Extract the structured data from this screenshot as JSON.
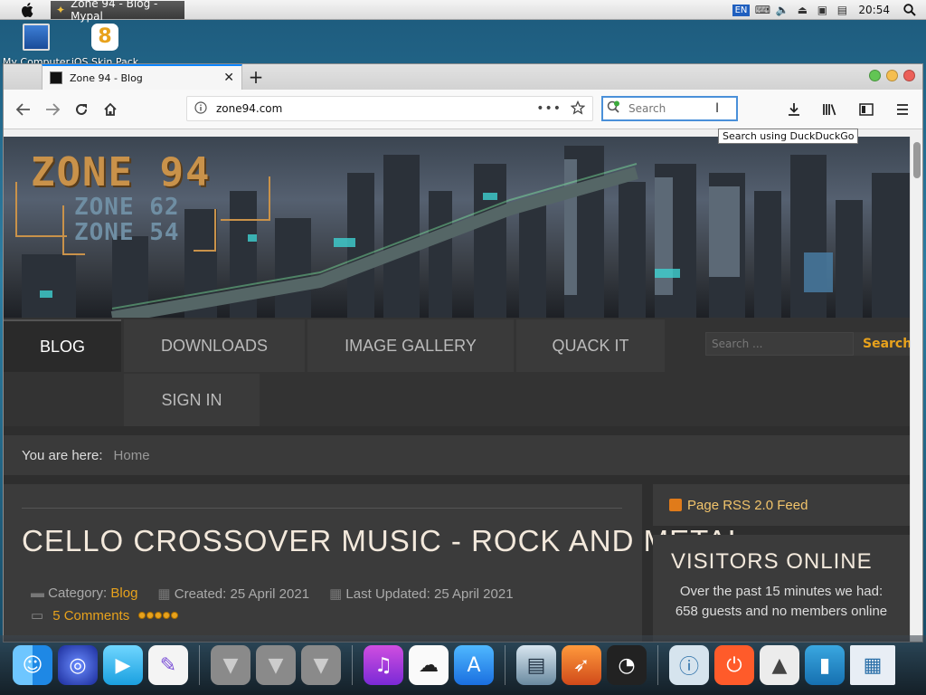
{
  "menubar": {
    "active_window": "Zone 94 - Blog - Mypal",
    "lang": "EN",
    "time": "20:54"
  },
  "desktop": {
    "icons": [
      {
        "label": "My Computer"
      },
      {
        "label": "iOS Skin Pack"
      }
    ]
  },
  "browser": {
    "tab_title": "Zone 94 - Blog",
    "url": "zone94.com",
    "search_placeholder": "Search",
    "search_tooltip": "Search using DuckDuckGo"
  },
  "site": {
    "logo_main": "ZONE 94",
    "logo_sub1": "ZONE 62",
    "logo_sub2": "ZONE 54",
    "nav": [
      {
        "label": "BLOG",
        "active": true
      },
      {
        "label": "DOWNLOADS"
      },
      {
        "label": "IMAGE GALLERY"
      },
      {
        "label": "QUACK IT"
      },
      {
        "label": "SIGN IN"
      }
    ],
    "search_placeholder": "Search ...",
    "search_button": "Search",
    "breadcrumb_label": "You are here:",
    "breadcrumb_value": "Home",
    "article": {
      "title": "CELLO CROSSOVER MUSIC - ROCK AND METAL",
      "category_label": "Category:",
      "category_value": "Blog",
      "created": "Created: 25 April 2021",
      "updated": "Last Updated: 25 April 2021",
      "comments": "5 Comments"
    },
    "sidebar": {
      "rss": "Page RSS 2.0 Feed",
      "visitors_title": "VISITORS ONLINE",
      "visitors_text": "Over the past 15 minutes we had: 658 guests and no members online"
    }
  },
  "colors": {
    "accent": "#e8a21c",
    "logo": "#c9924a",
    "page_bg": "#2e2e2e"
  }
}
